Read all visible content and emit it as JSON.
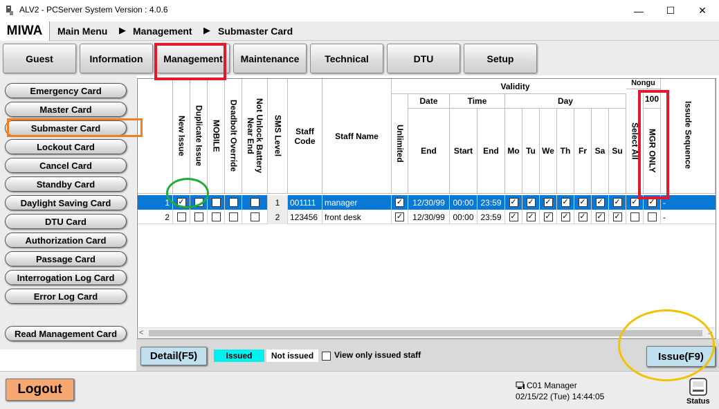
{
  "window": {
    "title": "ALV2 - PCServer System Version : 4.0.6",
    "minimize": "—",
    "maximize": "☐",
    "close": "✕"
  },
  "breadcrumb": {
    "brand": "MIWA",
    "items": [
      "Main Menu",
      "Management",
      "Submaster Card"
    ],
    "separator": "▶"
  },
  "tabs": [
    "Guest",
    "Information",
    "Management",
    "Maintenance",
    "Technical",
    "DTU",
    "Setup"
  ],
  "active_tab": "Management",
  "sidebar": {
    "items": [
      "Emergency Card",
      "Master Card",
      "Submaster Card",
      "Lockout Card",
      "Cancel Card",
      "Standby Card",
      "Daylight Saving Card",
      "DTU Card",
      "Authorization Card",
      "Passage Card",
      "Interrogation Log Card",
      "Error Log Card"
    ],
    "selected": "Submaster Card",
    "read_button": "Read Management Card"
  },
  "grid": {
    "headers": {
      "new_issue": "New Issue",
      "duplicate_issue": "Duplicate Issue",
      "mobile": "MOBILE",
      "deadbolt_override": "Deadbolt Override",
      "not_unlock_battery": "Not Unlock Battery Near End",
      "sms_level": "SMS Level",
      "staff_code": "Staff Code",
      "staff_name": "Staff Name",
      "validity": "Validity",
      "unlimited": "Unlimited",
      "date": "Date",
      "date_end": "End",
      "time": "Time",
      "time_start": "Start",
      "time_end": "End",
      "day": "Day",
      "days": [
        "Mo",
        "Tu",
        "We",
        "Th",
        "Fr",
        "Sa",
        "Su"
      ],
      "nonguest": "Nongu est",
      "select_all": "Select All",
      "mgr_number": "100",
      "mgr_only": "MGR ONLY",
      "issue_sequence": "Issude Sequence"
    },
    "rows": [
      {
        "num": "1",
        "new_issue": true,
        "duplicate": false,
        "mobile": false,
        "deadbolt": false,
        "not_unlock": false,
        "sms_level": "1",
        "staff_code": "001111",
        "staff_name": "manager",
        "unlimited": true,
        "date_end": "12/30/99",
        "time_start": "00:00",
        "time_end": "23:59",
        "days": [
          true,
          true,
          true,
          true,
          true,
          true,
          true
        ],
        "select_all": true,
        "mgr_only": true,
        "sequence": "-",
        "selected": true
      },
      {
        "num": "2",
        "new_issue": false,
        "duplicate": false,
        "mobile": false,
        "deadbolt": false,
        "not_unlock": false,
        "sms_level": "2",
        "staff_code": "123456",
        "staff_name": "front desk",
        "unlimited": true,
        "date_end": "12/30/99",
        "time_start": "00:00",
        "time_end": "23:59",
        "days": [
          true,
          true,
          true,
          true,
          true,
          true,
          true
        ],
        "select_all": false,
        "mgr_only": false,
        "sequence": "-",
        "selected": false
      }
    ]
  },
  "bottom": {
    "detail_button": "Detail(F5)",
    "legend_issued": "Issued",
    "legend_not_issued": "Not issued",
    "view_only_label": "View only issued staff",
    "issue_button": "Issue(F9)"
  },
  "footer": {
    "logout": "Logout",
    "station": "C01 Manager",
    "datetime": "02/15/22 (Tue) 14:44:05",
    "status_label": "Status"
  },
  "colors": {
    "selected_row": "#0a78d7",
    "issued_legend": "#00f0f0",
    "detail_button": "#bfe0ef",
    "issue_button": "#bfe0ef",
    "logout": "#f7a872",
    "annotation_red": "#e0192c",
    "annotation_orange": "#f07f1c",
    "annotation_green": "#1faa3a",
    "annotation_yellow": "#f2c100"
  }
}
